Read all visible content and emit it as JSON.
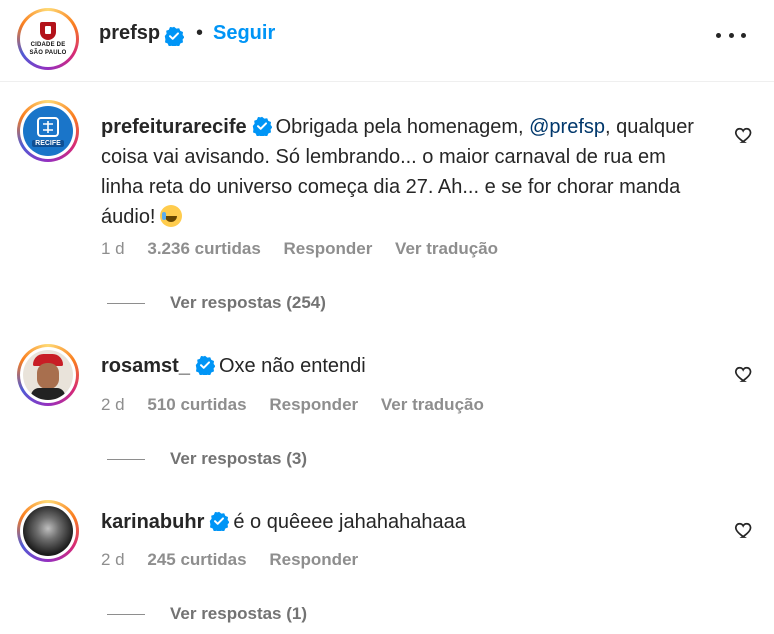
{
  "header": {
    "username": "prefsp",
    "avatar_text_line1": "CIDADE DE",
    "avatar_text_line2": "SÃO PAULO",
    "dot": "•",
    "follow_label": "Seguir"
  },
  "colors": {
    "link_blue": "#0095f6",
    "verified_blue": "#0095f6",
    "mention": "#00376b",
    "muted": "#8e8e8e"
  },
  "comments": [
    {
      "username": "prefeiturarecife",
      "text_before": "Obrigada pela homenagem, ",
      "mention": "@prefsp",
      "text_after": ", qualquer coisa vai avisando. Só lembrando... o maior carnaval de rua em linha reta do universo começa dia 27. Ah... e se for chorar manda áudio!",
      "emoji": "grinning-squinting-tears-emoji",
      "avatar_label": "RECIFE",
      "time": "1 d",
      "likes": "3.236 curtidas",
      "reply_label": "Responder",
      "translate_label": "Ver tradução",
      "view_replies": "Ver respostas (254)"
    },
    {
      "username": "rosamst_",
      "text": "Oxe não entendi",
      "time": "2 d",
      "likes": "510 curtidas",
      "reply_label": "Responder",
      "translate_label": "Ver tradução",
      "view_replies": "Ver respostas (3)"
    },
    {
      "username": "karinabuhr",
      "text": "é o quêeee jahahahahaaa",
      "time": "2 d",
      "likes": "245 curtidas",
      "reply_label": "Responder",
      "view_replies": "Ver respostas (1)"
    }
  ]
}
